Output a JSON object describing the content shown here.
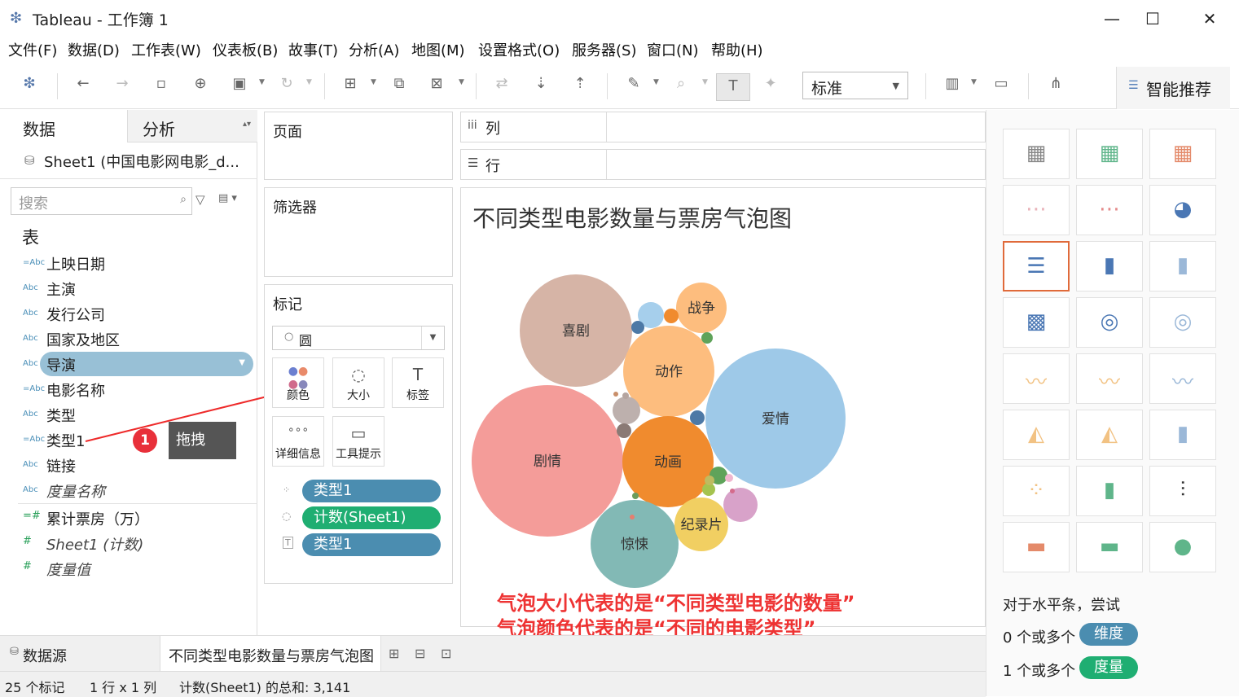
{
  "window": {
    "title": "Tableau - 工作簿 1",
    "min": "—",
    "max": "☐",
    "close": "✕"
  },
  "menu": [
    "文件(F)",
    "数据(D)",
    "工作表(W)",
    "仪表板(B)",
    "故事(T)",
    "分析(A)",
    "地图(M)",
    "设置格式(O)",
    "服务器(S)",
    "窗口(N)",
    "帮助(H)"
  ],
  "toolbar": {
    "fit_select": "标准",
    "smart_recommend": "智能推荐"
  },
  "data_pane": {
    "tab_data": "数据",
    "tab_analysis": "分析",
    "datasource": "Sheet1 (中国电影网电影_d...",
    "search_placeholder": "搜索",
    "section_table": "表",
    "dimensions": [
      {
        "type": "=Abc",
        "name": "上映日期"
      },
      {
        "type": "Abc",
        "name": "主演"
      },
      {
        "type": "Abc",
        "name": "发行公司"
      },
      {
        "type": "Abc",
        "name": "国家及地区"
      },
      {
        "type": "Abc",
        "name": "导演"
      },
      {
        "type": "=Abc",
        "name": "电影名称"
      },
      {
        "type": "Abc",
        "name": "类型"
      },
      {
        "type": "=Abc",
        "name": "类型1"
      },
      {
        "type": "Abc",
        "name": "链接"
      },
      {
        "type": "Abc",
        "name": "度量名称"
      }
    ],
    "measures": [
      {
        "type": "=#",
        "name": "累计票房（万）"
      },
      {
        "type": "#",
        "name": "Sheet1 (计数)"
      },
      {
        "type": "#",
        "name": "度量值"
      }
    ]
  },
  "drag_hint": {
    "step": "1",
    "label": "拖拽"
  },
  "shelves": {
    "pages": "页面",
    "filters": "筛选器",
    "marks": "标记",
    "mark_type": "圆",
    "columns": "列",
    "rows": "行"
  },
  "mark_buttons": [
    {
      "icon": "color-icon",
      "label": "颜色"
    },
    {
      "icon": "size-icon",
      "label": "大小"
    },
    {
      "icon": "label-icon",
      "label": "标签"
    },
    {
      "icon": "detail-icon",
      "label": "详细信息"
    },
    {
      "icon": "tooltip-icon",
      "label": "工具提示"
    }
  ],
  "mark_pills": [
    {
      "encoding": "color",
      "label": "类型1",
      "kind": "dim"
    },
    {
      "encoding": "size",
      "label": "计数(Sheet1)",
      "kind": "mea"
    },
    {
      "encoding": "label",
      "label": "类型1",
      "kind": "dim"
    }
  ],
  "viz": {
    "title": "不同类型电影数量与票房气泡图",
    "annotation_1": "气泡大小代表的是“不同类型电影的数量”",
    "annotation_2": "气泡颜色代表的是“不同的电影类型”"
  },
  "chart_data": {
    "type": "bubble",
    "title": "不同类型电影数量与票房气泡图",
    "size_field": "计数(Sheet1)",
    "color_field": "类型1",
    "bubbles": [
      {
        "label": "剧情",
        "color": "#f49c99"
      },
      {
        "label": "爱情",
        "color": "#9ec9e8"
      },
      {
        "label": "喜剧",
        "color": "#d6b4a6"
      },
      {
        "label": "动作",
        "color": "#fdbd7e"
      },
      {
        "label": "动画",
        "color": "#f08b2e"
      },
      {
        "label": "惊悚",
        "color": "#82b9b5"
      },
      {
        "label": "纪录片",
        "color": "#f1cf62"
      },
      {
        "label": "战争",
        "color": "#fdbd7e"
      },
      {
        "label": "",
        "color": "#d8a2c9"
      },
      {
        "label": "",
        "color": "#bdb0ad"
      },
      {
        "label": "",
        "color": "#a6cfec"
      },
      {
        "label": "",
        "color": "#5fa35a"
      },
      {
        "label": "",
        "color": "#8a7a75"
      },
      {
        "label": "",
        "color": "#4d79a6"
      },
      {
        "label": "",
        "color": "#4d79a6"
      },
      {
        "label": "",
        "color": "#f08b2e"
      },
      {
        "label": "",
        "color": "#a5c34f"
      },
      {
        "label": "",
        "color": "#5fa35a"
      },
      {
        "label": "",
        "color": "#f0b6cf"
      },
      {
        "label": "",
        "color": "#bfbb60"
      },
      {
        "label": "",
        "color": "#b5a5a0"
      },
      {
        "label": "",
        "color": "#6b9c5c"
      },
      {
        "label": "",
        "color": "#e67e6e"
      },
      {
        "label": "",
        "color": "#d46b8c"
      },
      {
        "label": "",
        "color": "#c98f6a"
      }
    ]
  },
  "showme": {
    "hint": "对于水平条，尝试",
    "req_dim_count": "0 个或多个",
    "req_dim": "维度",
    "req_mea_count": "1 个或多个",
    "req_mea": "度量"
  },
  "sheet_tabs": {
    "datasource": "数据源",
    "active_sheet": "不同类型电影数量与票房气泡图"
  },
  "status": {
    "marks": "25 个标记",
    "grid": "1 行 x 1 列",
    "sum": "计数(Sheet1) 的总和: 3,141"
  }
}
